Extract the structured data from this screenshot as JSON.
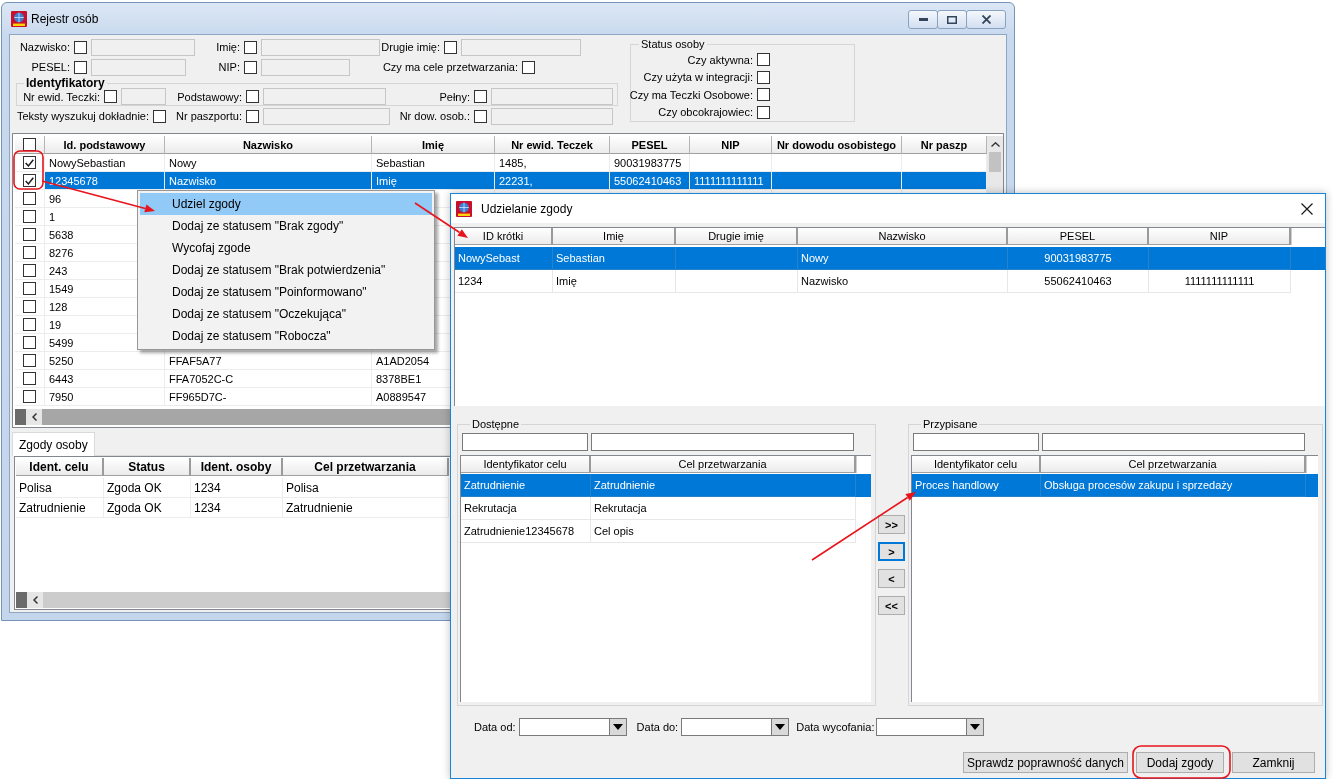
{
  "main_window": {
    "title": "Rejestr osób",
    "filter_rows": [
      [
        {
          "label": "Nazwisko:",
          "kind": "text",
          "checked": false,
          "disabled": true
        },
        {
          "label": "Imię:",
          "kind": "text",
          "checked": false,
          "disabled": true
        },
        {
          "label": "Drugie imię:",
          "kind": "text",
          "checked": false,
          "disabled": true
        }
      ],
      [
        {
          "label": "PESEL:",
          "kind": "text",
          "checked": false,
          "disabled": true
        },
        {
          "label": "NIP:",
          "kind": "text",
          "checked": false,
          "disabled": true
        },
        {
          "label": "Czy ma cele przetwarzania:",
          "kind": "flag",
          "checked": false
        }
      ]
    ],
    "identifiers": {
      "title": "Identyfikatory",
      "fields": [
        {
          "label": "Nr ewid. Teczki:",
          "kind": "text",
          "checked": false,
          "disabled": true
        },
        {
          "label": "Podstawowy:",
          "kind": "text",
          "checked": false,
          "disabled": true
        },
        {
          "label": "Pełny:",
          "kind": "text",
          "checked": false,
          "disabled": true
        }
      ]
    },
    "search_row": [
      {
        "label": "Teksty wyszukuj dokładnie:",
        "kind": "flag",
        "checked": false
      },
      {
        "label": "Nr paszportu:",
        "kind": "text",
        "checked": false,
        "disabled": true
      },
      {
        "label": "Nr dow. osob.:",
        "kind": "text",
        "checked": false,
        "disabled": true
      }
    ],
    "status_group": {
      "title": "Status osoby",
      "fields": [
        {
          "label": "Czy aktywna:",
          "checked": false
        },
        {
          "label": "Czy użyta w integracji:",
          "checked": false
        },
        {
          "label": "Czy ma Teczki Osobowe:",
          "checked": false
        },
        {
          "label": "Czy obcokrajowiec:",
          "checked": false
        }
      ]
    },
    "person_table": {
      "all_checked": false,
      "columns": [
        "Id. podstawowy",
        "Nazwisko",
        "Imię",
        "Nr ewid. Teczek",
        "PESEL",
        "NIP",
        "Nr dowodu osobistego",
        "Nr paszp"
      ],
      "rows": [
        {
          "checked": true,
          "selected": false,
          "id": "NowySebastian",
          "surname": "Nowy",
          "first_name": "Sebastian",
          "file_no": "1485,",
          "pesel": "90031983775"
        },
        {
          "checked": true,
          "selected": true,
          "id": "12345678",
          "surname": "Nazwisko",
          "first_name": "Imię",
          "file_no": "22231,",
          "pesel": "55062410463",
          "nip": "1111111111111"
        },
        {
          "checked": false,
          "selected": false,
          "id": "96"
        },
        {
          "checked": false,
          "selected": false,
          "id": "1"
        },
        {
          "checked": false,
          "selected": false,
          "id": "5638"
        },
        {
          "checked": false,
          "selected": false,
          "id": "8276"
        },
        {
          "checked": false,
          "selected": false,
          "id": "243"
        },
        {
          "checked": false,
          "selected": false,
          "id": "1549"
        },
        {
          "checked": false,
          "selected": false,
          "id": "128"
        },
        {
          "checked": false,
          "selected": false,
          "id": "19"
        },
        {
          "checked": false,
          "selected": false,
          "id": "5499"
        },
        {
          "checked": false,
          "selected": false,
          "id": "5250",
          "surname": "FFAF5A77",
          "first_name": "A1AD2054"
        },
        {
          "checked": false,
          "selected": false,
          "id": "6443",
          "surname": "FFA7052C-C",
          "first_name": "8378BE1"
        },
        {
          "checked": false,
          "selected": false,
          "id": "7950",
          "surname": "FF965D7C-",
          "first_name": "A0889547"
        }
      ]
    },
    "tabs": [
      {
        "label": "Zgody osoby",
        "selected": true
      }
    ],
    "consents_table": {
      "columns": [
        "Ident. celu",
        "Status",
        "Ident. osoby",
        "Cel przetwarzania"
      ],
      "rows": [
        [
          "Polisa",
          "Zgoda OK",
          "1234",
          "Polisa"
        ],
        [
          "Zatrudnienie",
          "Zgoda OK",
          "1234",
          "Zatrudnienie"
        ]
      ]
    }
  },
  "context_menu": {
    "items": [
      {
        "label": "Udziel zgody",
        "selected": true
      },
      {
        "label": "Dodaj ze statusem \"Brak zgody\"",
        "selected": false
      },
      {
        "label": "Wycofaj zgode",
        "selected": false
      },
      {
        "label": "Dodaj ze statusem \"Brak potwierdzenia\"",
        "selected": false
      },
      {
        "label": "Dodaj ze statusem \"Poinformowano\"",
        "selected": false
      },
      {
        "label": "Dodaj ze statusem \"Oczekująca\"",
        "selected": false
      },
      {
        "label": "Dodaj ze statusem \"Robocza\"",
        "selected": false
      }
    ]
  },
  "dialog": {
    "title": "Udzielanie zgody",
    "persons": {
      "columns": [
        "ID krótki",
        "Imię",
        "Drugie imię",
        "Nazwisko",
        "PESEL",
        "NIP"
      ],
      "rows": [
        {
          "selected": true,
          "id": "NowySebast",
          "first_name": "Sebastian",
          "surname": "Nowy",
          "pesel": "90031983775"
        },
        {
          "selected": false,
          "id": "1234",
          "first_name": "Imię",
          "surname": "Nazwisko",
          "pesel": "55062410463",
          "nip": "1111111111111"
        }
      ]
    },
    "available": {
      "title": "Dostępne",
      "columns": [
        "Identyfikator celu",
        "Cel przetwarzania"
      ],
      "rows": [
        {
          "selected": true,
          "cells": [
            "Zatrudnienie",
            "Zatrudnienie"
          ]
        },
        {
          "selected": false,
          "cells": [
            "Rekrutacja",
            "Rekrutacja"
          ]
        },
        {
          "selected": false,
          "cells": [
            "Zatrudnienie12345678",
            "Cel opis"
          ]
        }
      ]
    },
    "transfer_buttons": [
      {
        "label": ">>",
        "focused": false
      },
      {
        "label": ">",
        "focused": true
      },
      {
        "label": "<",
        "focused": false
      },
      {
        "label": "<<",
        "focused": false
      }
    ],
    "assigned": {
      "title": "Przypisane",
      "columns": [
        "Identyfikator celu",
        "Cel przetwarzania"
      ],
      "rows": [
        {
          "selected": true,
          "cells": [
            "Proces handlowy",
            "Obsługa procesów zakupu i sprzedaży"
          ]
        }
      ]
    },
    "dates": [
      {
        "label": "Data od:"
      },
      {
        "label": "Data do:"
      },
      {
        "label": "Data wycofania:"
      }
    ],
    "buttons": [
      "Sprawdz poprawność danych",
      "Dodaj zgody",
      "Zamknij"
    ]
  }
}
